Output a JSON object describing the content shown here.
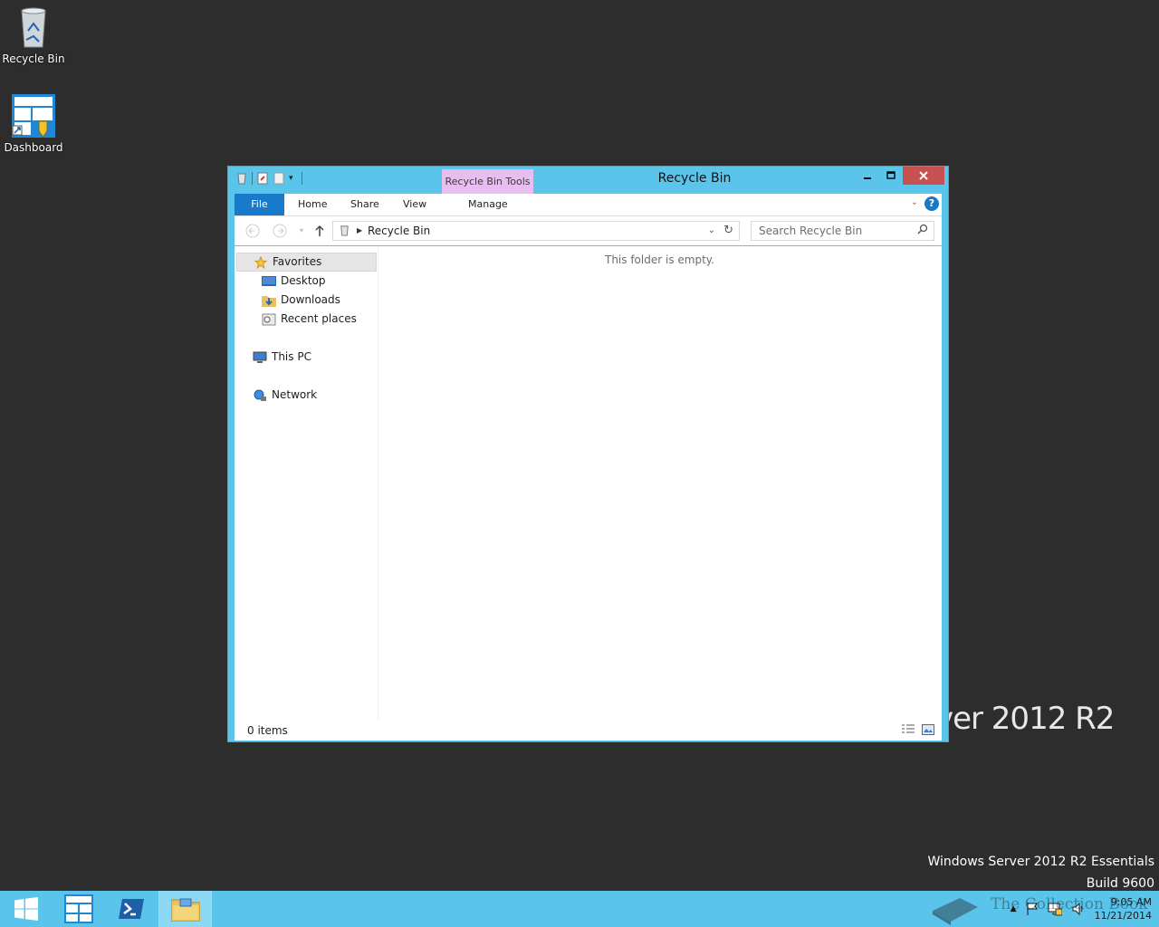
{
  "desktop": {
    "icons": [
      {
        "label": "Recycle Bin",
        "icon": "recycle-bin-icon"
      },
      {
        "label": "Dashboard",
        "icon": "dashboard-icon"
      }
    ],
    "watermark": "rver 2012 R2",
    "edition_line1": "Windows Server 2012 R2 Essentials",
    "edition_line2": "Build 9600"
  },
  "window": {
    "title": "Recycle Bin",
    "context_tab_header": "Recycle Bin Tools",
    "ribbon_tabs": [
      "File",
      "Home",
      "Share",
      "View",
      "Manage"
    ],
    "address": {
      "crumb": "Recycle Bin"
    },
    "search_placeholder": "Search Recycle Bin",
    "nav": {
      "favorites": "Favorites",
      "desktop": "Desktop",
      "downloads": "Downloads",
      "recent": "Recent places",
      "this_pc": "This PC",
      "network": "Network"
    },
    "empty_message": "This folder is empty.",
    "status_count": "0 items"
  },
  "taskbar": {
    "time": "9:05 AM",
    "date": "11/21/2014",
    "brand": "The Collection Book"
  },
  "colors": {
    "window_frame": "#5bc4ea",
    "file_tab": "#1979ca",
    "context_tab": "#e8bdf0",
    "close_button": "#c75050",
    "desktop": "#2d2d2d"
  }
}
